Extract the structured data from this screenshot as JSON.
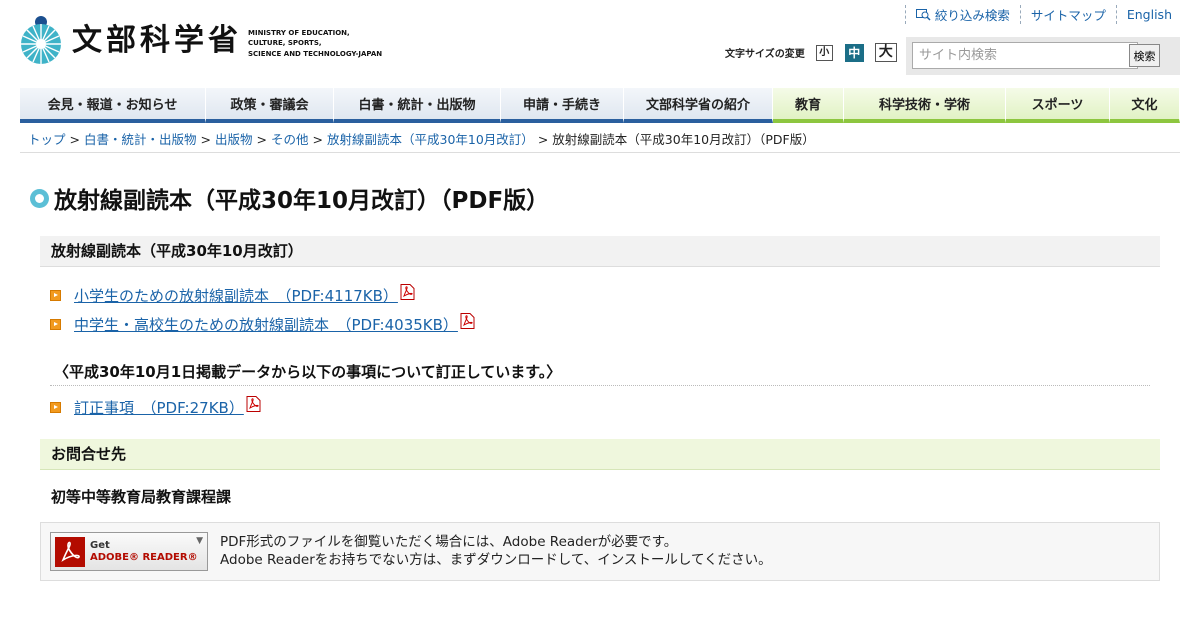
{
  "header": {
    "logo_jp": "文部科学省",
    "logo_en": "MINISTRY OF EDUCATION,\nCULTURE, SPORTS,\nSCIENCE AND TECHNOLOGY-JAPAN",
    "top_links": [
      "絞り込み検索",
      "サイトマップ",
      "English"
    ],
    "font_size_label": "文字サイズの変更",
    "font_sizes": [
      "小",
      "中",
      "大"
    ],
    "search_placeholder": "サイト内検索",
    "search_button": "検索"
  },
  "gnav": {
    "items": [
      {
        "label": "会見・報道・お知らせ",
        "style": "blue"
      },
      {
        "label": "政策・審議会",
        "style": "blue"
      },
      {
        "label": "白書・統計・出版物",
        "style": "blue"
      },
      {
        "label": "申請・手続き",
        "style": "blue"
      },
      {
        "label": "文部科学省の紹介",
        "style": "blue"
      },
      {
        "label": "教育",
        "style": "green"
      },
      {
        "label": "科学技術・学術",
        "style": "green"
      },
      {
        "label": "スポーツ",
        "style": "green"
      },
      {
        "label": "文化",
        "style": "green"
      }
    ]
  },
  "breadcrumb": {
    "links": [
      "トップ",
      "白書・統計・出版物",
      "出版物",
      "その他",
      "放射線副読本（平成30年10月改訂）"
    ],
    "current": "放射線副読本（平成30年10月改訂）（PDF版）",
    "separator": ">"
  },
  "page_title": "放射線副読本（平成30年10月改訂）（PDF版）",
  "section1": {
    "heading": "放射線副読本（平成30年10月改訂）",
    "links": [
      "小学生のための放射線副読本　（PDF:4117KB）",
      "中学生・高校生のための放射線副読本　（PDF:4035KB）"
    ]
  },
  "note": {
    "text": "〈平成30年10月1日掲載データから以下の事項について訂正しています。〉",
    "link": "訂正事項　（PDF:27KB）"
  },
  "contact": {
    "heading": "お問合せ先",
    "department": "初等中等教育局教育課程課"
  },
  "adobe": {
    "button_line1": "Get",
    "button_line2": "ADOBE® READER®",
    "text_line1": "PDF形式のファイルを御覧いただく場合には、Adobe Readerが必要です。",
    "text_line2": "Adobe Readerをお持ちでない方は、まずダウンロードして、インストールしてください。"
  },
  "colors": {
    "nav_blue": "#2a5f9e",
    "nav_green": "#8dc63f",
    "link": "#1a63a8",
    "bullet": "#f29a1f",
    "accent_title": "#5bbfd6"
  }
}
